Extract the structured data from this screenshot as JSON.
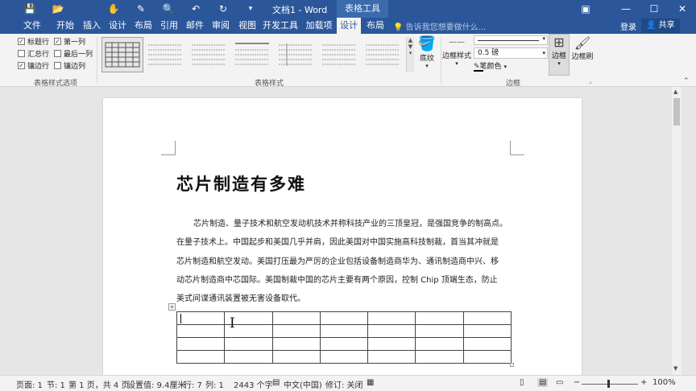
{
  "titlebar": {
    "title": "文档1 - Word",
    "context_tab": "表格工具",
    "qat": {
      "save": "💾",
      "open": "📂",
      "undo": "↶",
      "redo": "↻",
      "more": "▾"
    },
    "window": {
      "options": "▣",
      "minimize": "—",
      "maximize": "☐",
      "close": "✕"
    }
  },
  "tabs": {
    "items": [
      "文件",
      "开始",
      "插入",
      "设计",
      "布局",
      "引用",
      "邮件",
      "审阅",
      "视图",
      "开发工具",
      "加载项",
      "设计",
      "布局"
    ],
    "tell_me": "告诉我您想要做什么...",
    "login": "登录",
    "share": "共享"
  },
  "ribbon": {
    "options": {
      "header_row": "标题行",
      "first_column": "第一列",
      "total_row": "汇总行",
      "last_column": "最后一列",
      "banded_rows": "镶边行",
      "banded_columns": "镶边列",
      "group_label": "表格样式选项",
      "checked": {
        "header_row": true,
        "first_column": true,
        "total_row": false,
        "last_column": false,
        "banded_rows": true,
        "banded_columns": false
      }
    },
    "styles": {
      "group_label": "表格样式"
    },
    "shading": {
      "label": "底纹"
    },
    "borders": {
      "border_styles": "边框样式",
      "line_weight": "0.5 磅",
      "pen_color": "笔颜色",
      "borders_btn": "边框",
      "border_painter": "边框刷",
      "group_label": "边框"
    }
  },
  "document": {
    "heading": "芯片制造有多难",
    "lines": [
      "芯片制造、量子技术和航空发动机技术并称科技产业的三顶皇冠，是强国竞争的制高点。",
      "在量子技术上。中国起步和美国几乎并肩，因此美国对中国实施高科技制裁，首当其冲就是",
      "芯片制造和航空发动。美国打压最为严厉的企业包括设备制造商华为、通讯制造商中兴、移",
      "动芯片制造商中芯国际。美国制裁中国的芯片主要有两个原因，控制 Chip 顶端生态，防止",
      "美式间谍通讯装置被无害设备取代。"
    ],
    "table": {
      "rows": 4,
      "cols": 7
    }
  },
  "status": {
    "page": "页面: 1",
    "section": "节: 1",
    "page_of": "第 1 页，共 4 页",
    "position": "设置值: 9.4厘米",
    "row": "行: 7",
    "col": "列: 1",
    "words": "2443 个字",
    "language": "中文(中国)",
    "track": "修订: 关闭",
    "zoom": "100%"
  },
  "colors": {
    "accent": "#2b579a",
    "ribbon": "#f3f3f3"
  }
}
